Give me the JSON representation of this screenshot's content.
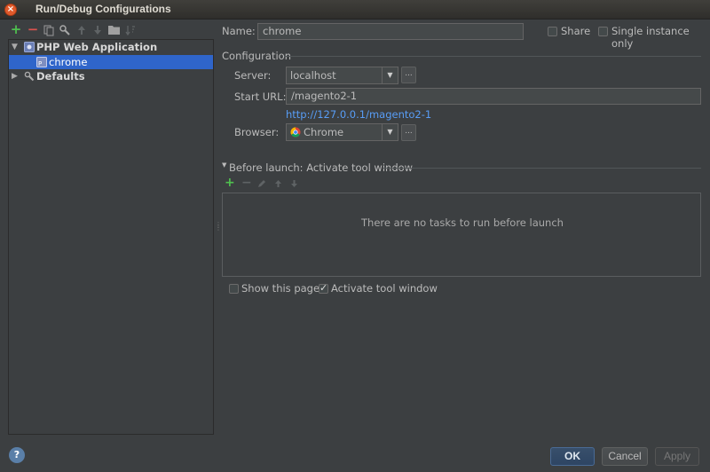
{
  "window": {
    "title": "Run/Debug Configurations",
    "close_glyph": "×"
  },
  "toolbar": {
    "icons": [
      "add-icon",
      "remove-icon",
      "copy-icon",
      "edit-defaults-icon",
      "move-up-icon",
      "move-down-icon",
      "folder-icon",
      "sort-icon"
    ],
    "add_glyph": "+",
    "remove_glyph": "−"
  },
  "tree": {
    "group_label": "PHP Web Application",
    "item_label": "chrome",
    "defaults_label": "Defaults"
  },
  "form": {
    "name_label": "Name:",
    "name_value": "chrome",
    "share_label": "Share",
    "single_instance_label": "Single instance only",
    "configuration_header": "Configuration",
    "server_label": "Server:",
    "server_value": "localhost",
    "start_url_label": "Start URL:",
    "start_url_value": "/magento2-1",
    "resolved_url": "http://127.0.0.1/magento2-1",
    "browser_label": "Browser:",
    "browser_value": "Chrome",
    "dots": "..."
  },
  "before_launch": {
    "header": "Before launch: Activate tool window",
    "empty_message": "There are no tasks to run before launch"
  },
  "options": {
    "show_this_page_label": "Show this page",
    "show_this_page_checked": false,
    "activate_tool_window_label": "Activate tool window",
    "activate_tool_window_checked": true
  },
  "buttons": {
    "ok": "OK",
    "cancel": "Cancel",
    "apply": "Apply",
    "help": "?"
  },
  "colors": {
    "accent": "#2f65ca",
    "link": "#589df6",
    "background": "#3c3f41"
  }
}
